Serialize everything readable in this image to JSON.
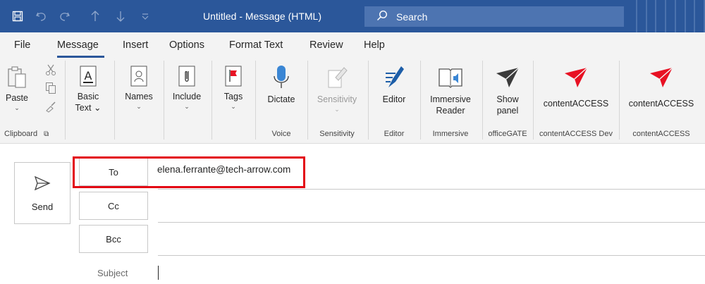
{
  "titlebar": {
    "title": "Untitled  -  Message (HTML)",
    "search_placeholder": "Search",
    "bg": "#2b579a",
    "icons": [
      "save-icon",
      "undo-icon",
      "redo-icon",
      "up-arrow-icon",
      "down-arrow-icon",
      "customize-qat-icon",
      "search-icon"
    ]
  },
  "tabs": [
    "File",
    "Message",
    "Insert",
    "Options",
    "Format Text",
    "Review",
    "Help"
  ],
  "active_tab": "Message",
  "ribbon": {
    "clipboard": {
      "paste": "Paste",
      "group": "Clipboard"
    },
    "basic_text": {
      "label": "Basic",
      "label2": "Text"
    },
    "names": {
      "label": "Names"
    },
    "include": {
      "label": "Include"
    },
    "tags": {
      "label": "Tags"
    },
    "voice": {
      "dictate": "Dictate",
      "group": "Voice"
    },
    "sensitivity": {
      "label": "Sensitivity",
      "group": "Sensitivity"
    },
    "editor": {
      "label": "Editor",
      "group": "Editor"
    },
    "immersive": {
      "label": "Immersive",
      "label2": "Reader",
      "group": "Immersive"
    },
    "officegate": {
      "label": "Show",
      "label2": "panel",
      "group": "officeGATE"
    },
    "contentaccess_dev": {
      "label": "contentACCESS",
      "group": "contentACCESS Dev"
    },
    "contentaccess": {
      "label": "contentACCESS",
      "group": "contentACCESS"
    }
  },
  "compose": {
    "send": "Send",
    "to_label": "To",
    "to_value": "elena.ferrante@tech-arrow.com",
    "cc_label": "Cc",
    "bcc_label": "Bcc",
    "subject_label": "Subject",
    "highlight_color": "#e30613"
  }
}
